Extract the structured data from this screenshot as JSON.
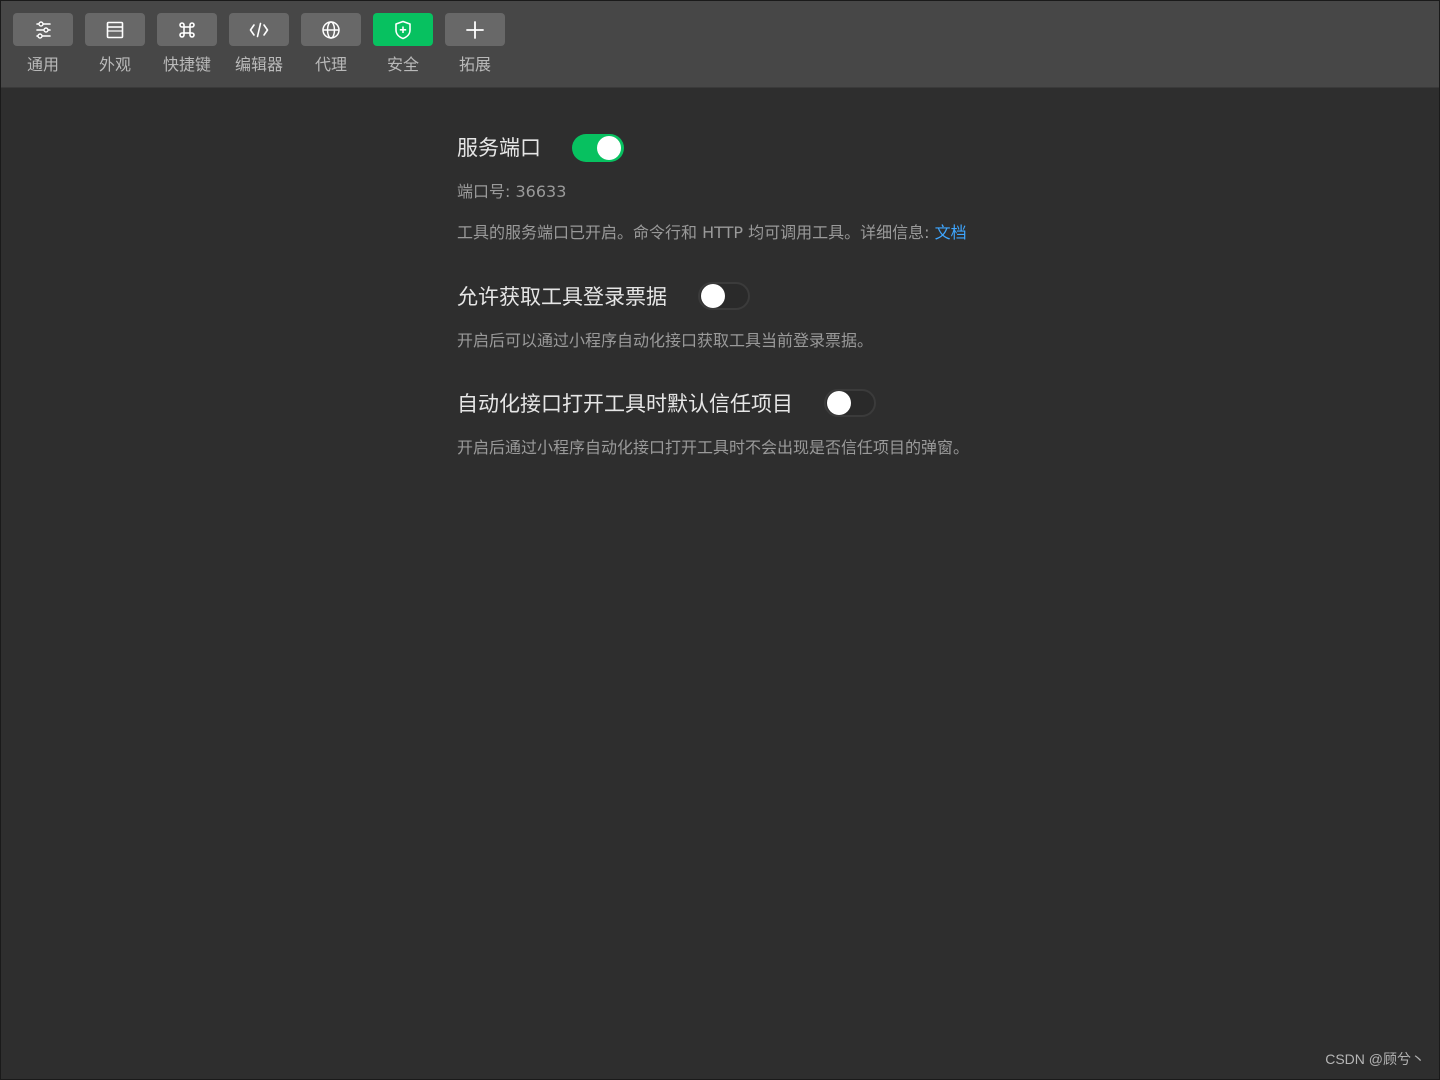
{
  "toolbar": {
    "tabs": [
      {
        "label": "通用",
        "icon": "list-settings-icon",
        "active": false
      },
      {
        "label": "外观",
        "icon": "window-layout-icon",
        "active": false
      },
      {
        "label": "快捷键",
        "icon": "command-key-icon",
        "active": false
      },
      {
        "label": "编辑器",
        "icon": "code-icon",
        "active": false
      },
      {
        "label": "代理",
        "icon": "globe-icon",
        "active": false
      },
      {
        "label": "安全",
        "icon": "shield-plus-icon",
        "active": true
      },
      {
        "label": "拓展",
        "icon": "plus-icon",
        "active": false
      }
    ]
  },
  "settings": {
    "service_port": {
      "title": "服务端口",
      "enabled": true,
      "port_label": "端口号: 36633",
      "desc_text": "工具的服务端口已开启。命令行和 HTTP 均可调用工具。详细信息: ",
      "doc_link": "文档"
    },
    "allow_ticket": {
      "title": "允许获取工具登录票据",
      "enabled": false,
      "desc": "开启后可以通过小程序自动化接口获取工具当前登录票据。"
    },
    "trust_project": {
      "title": "自动化接口打开工具时默认信任项目",
      "enabled": false,
      "desc": "开启后通过小程序自动化接口打开工具时不会出现是否信任项目的弹窗。"
    }
  },
  "colors": {
    "accent": "#07c160",
    "link": "#3ea6ff",
    "background": "#2e2e2e",
    "toolbar": "#474747"
  },
  "watermark": "CSDN @顾兮丶"
}
